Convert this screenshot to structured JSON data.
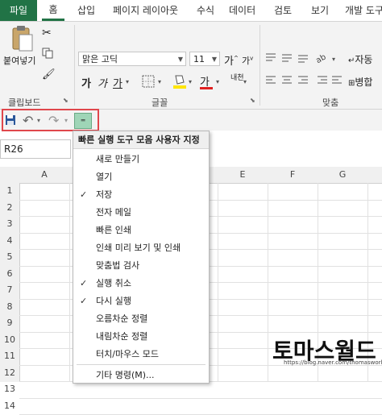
{
  "tabs": [
    "파일",
    "홈",
    "삽입",
    "페이지 레이아웃",
    "수식",
    "데이터",
    "검토",
    "보기",
    "개발 도구"
  ],
  "ribbon": {
    "clipboard": {
      "paste_label": "붙여넣기",
      "group_label": "클립보드"
    },
    "font": {
      "font_name": "맑은 고딕",
      "font_size": "11",
      "grow_label": "가",
      "shrink_label": "가",
      "bold": "가",
      "italic": "가",
      "underline": "가",
      "phonetic_label": "내천",
      "group_label": "글꼴"
    },
    "alignment": {
      "wrap_label": "자동",
      "merge_label": "병합",
      "group_label": "맞춤"
    }
  },
  "namebox": "R26",
  "columns": [
    "A",
    "E",
    "F",
    "G"
  ],
  "rows": [
    "1",
    "2",
    "3",
    "4",
    "5",
    "6",
    "7",
    "8",
    "9",
    "10",
    "11",
    "12",
    "13",
    "14"
  ],
  "menu": {
    "title": "빠른 실행 도구 모음 사용자 지정",
    "items": [
      {
        "label": "새로 만들기",
        "checked": false
      },
      {
        "label": "열기",
        "checked": false
      },
      {
        "label": "저장",
        "checked": true
      },
      {
        "label": "전자 메일",
        "checked": false
      },
      {
        "label": "빠른 인쇄",
        "checked": false
      },
      {
        "label": "인쇄 미리 보기 및 인쇄",
        "checked": false
      },
      {
        "label": "맞춤법 검사",
        "checked": false
      },
      {
        "label": "실행 취소",
        "checked": true
      },
      {
        "label": "다시 실행",
        "checked": true
      },
      {
        "label": "오름차순 정렬",
        "checked": false
      },
      {
        "label": "내림차순 정렬",
        "checked": false
      },
      {
        "label": "터치/마우스 모드",
        "checked": false
      },
      {
        "label": "기타 명령(M)...",
        "checked": false
      }
    ]
  },
  "watermark": {
    "title": "토마스월드",
    "url": "https://blog.naver.com/thomasworld"
  },
  "colors": {
    "accent": "#217346",
    "highlight": "#e0474c",
    "qat_active": "#9fd5b7"
  }
}
